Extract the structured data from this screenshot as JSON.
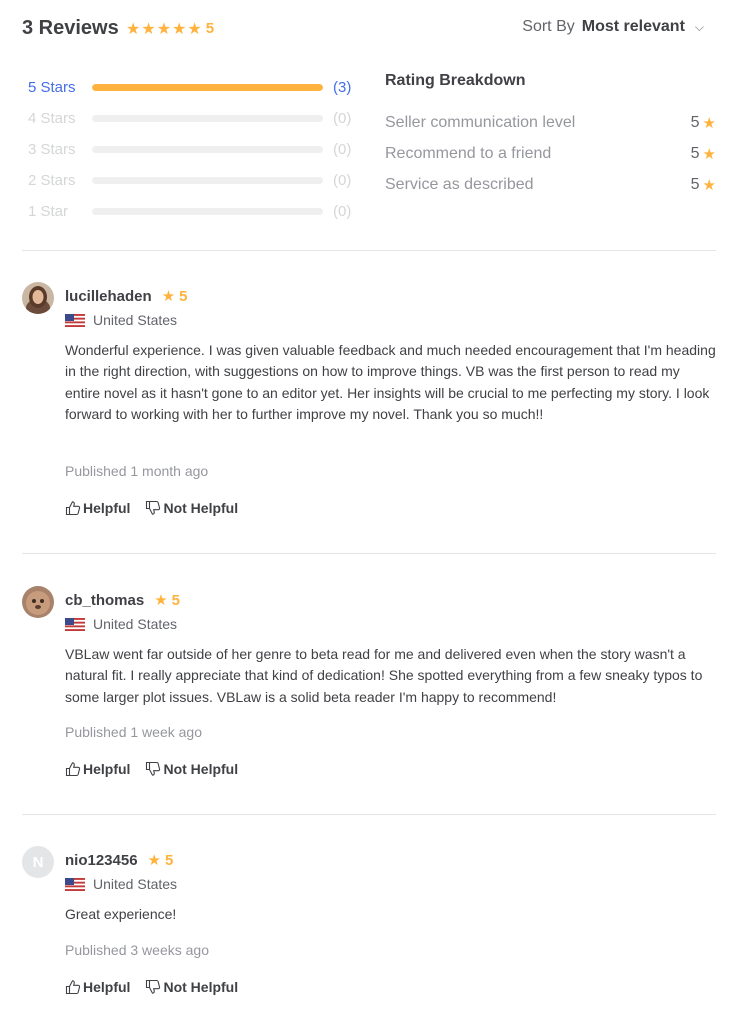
{
  "header": {
    "title": "3 Reviews",
    "rating": "5",
    "sort_label": "Sort By",
    "sort_value": "Most relevant"
  },
  "star_bars": [
    {
      "label": "5 Stars",
      "count": "(3)",
      "fill_fraction": 1.0
    },
    {
      "label": "4 Stars",
      "count": "(0)",
      "fill_fraction": 0
    },
    {
      "label": "3 Stars",
      "count": "(0)",
      "fill_fraction": 0
    },
    {
      "label": "2 Stars",
      "count": "(0)",
      "fill_fraction": 0
    },
    {
      "label": "1 Star",
      "count": "(0)",
      "fill_fraction": 0
    }
  ],
  "breakdown": {
    "title": "Rating Breakdown",
    "rows": [
      {
        "label": "Seller communication level",
        "score": "5"
      },
      {
        "label": "Recommend to a friend",
        "score": "5"
      },
      {
        "label": "Service as described",
        "score": "5"
      }
    ]
  },
  "reviews": [
    {
      "username": "lucillehaden",
      "rating": "5",
      "country": "United States",
      "text": "Wonderful experience. I was given valuable feedback and much needed encouragement that I'm heading in the right direction, with suggestions on how to improve things. VB was the first person to read my entire novel as it hasn't gone to an editor yet. Her insights will be crucial to me perfecting my story. I look forward to working with her to further improve my novel. Thank you so much!!",
      "published": "Published 1 month ago",
      "helpful": "Helpful",
      "not_helpful": "Not Helpful"
    },
    {
      "username": "cb_thomas",
      "rating": "5",
      "country": "United States",
      "text": "VBLaw went far outside of her genre to beta read for me and delivered even when the story wasn't a natural fit. I really appreciate that kind of dedication! She spotted everything from a few sneaky typos to some larger plot issues. VBLaw is a solid beta reader I'm happy to recommend!",
      "published": "Published 1 week ago",
      "helpful": "Helpful",
      "not_helpful": "Not Helpful"
    },
    {
      "username": "nio123456",
      "avatar_letter": "N",
      "rating": "5",
      "country": "United States",
      "text": "Great experience!",
      "published": "Published 3 weeks ago",
      "helpful": "Helpful",
      "not_helpful": "Not Helpful"
    }
  ],
  "colors": {
    "star": "#ffb33e",
    "link_blue": "#446ee7",
    "text": "#404145",
    "muted": "#95979d"
  }
}
